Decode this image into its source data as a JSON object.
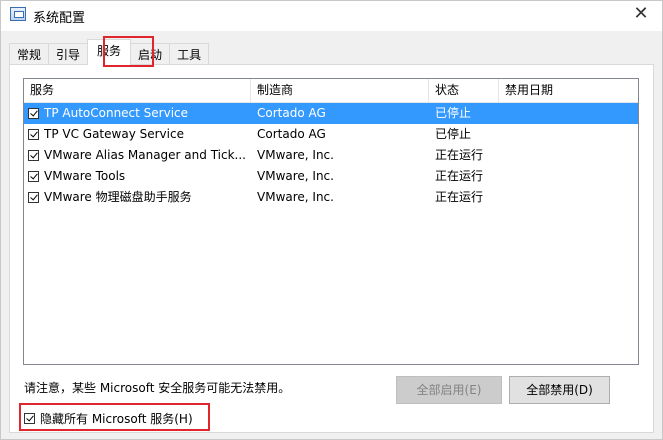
{
  "window": {
    "title": "系统配置",
    "close_glyph": "✕"
  },
  "tabs": [
    {
      "label": "常规",
      "active": false
    },
    {
      "label": "引导",
      "active": false
    },
    {
      "label": "服务",
      "active": true
    },
    {
      "label": "启动",
      "active": false
    },
    {
      "label": "工具",
      "active": false
    }
  ],
  "services_list": {
    "columns": [
      "服务",
      "制造商",
      "状态",
      "禁用日期"
    ],
    "rows": [
      {
        "name": "TP AutoConnect Service",
        "manufacturer": "Cortado AG",
        "status": "已停止",
        "disabled_date": "",
        "checked": true,
        "selected": true
      },
      {
        "name": "TP VC Gateway Service",
        "manufacturer": "Cortado AG",
        "status": "已停止",
        "disabled_date": "",
        "checked": true,
        "selected": false
      },
      {
        "name": "VMware Alias Manager and Tick...",
        "manufacturer": "VMware, Inc.",
        "status": "正在运行",
        "disabled_date": "",
        "checked": true,
        "selected": false
      },
      {
        "name": "VMware Tools",
        "manufacturer": "VMware, Inc.",
        "status": "正在运行",
        "disabled_date": "",
        "checked": true,
        "selected": false
      },
      {
        "name": "VMware 物理磁盘助手服务",
        "manufacturer": "VMware, Inc.",
        "status": "正在运行",
        "disabled_date": "",
        "checked": true,
        "selected": false
      }
    ]
  },
  "footer": {
    "notice": "请注意，某些 Microsoft 安全服务可能无法禁用。",
    "enable_all_label": "全部启用(E)",
    "disable_all_label": "全部禁用(D)",
    "hide_ms_label": "隐藏所有 Microsoft 服务(H)",
    "hide_ms_checked": true
  },
  "colors": {
    "selection": "#3399ff",
    "highlight_box": "#e0262d"
  }
}
